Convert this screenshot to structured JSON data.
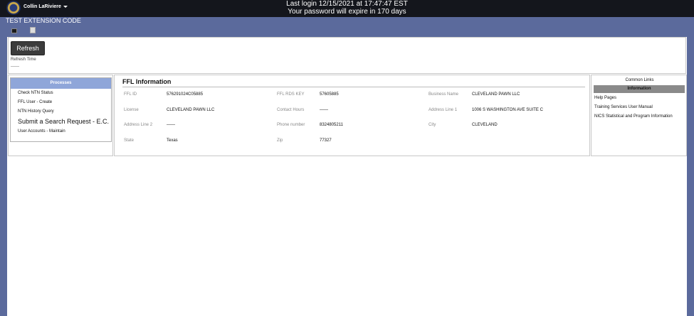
{
  "header": {
    "user_name": "Collin LaRiviere",
    "login_line": "Last login 12/15/2021 at 17:47:47 EST",
    "expire_line": "Your password will expire in 170 days"
  },
  "band": {
    "environment_title": "TEST EXTENSION CODE"
  },
  "refresh": {
    "button_label": "Refresh",
    "time_label": "Refresh Time",
    "time_value": "——"
  },
  "processes": {
    "header": "Processes",
    "items": [
      "Check NTN Status",
      "FFL User - Create",
      "NTN History Query",
      "Submit a Search Request - E.C.",
      "User Accounts - Maintain"
    ]
  },
  "ffl": {
    "title": "FFL Information",
    "fields": {
      "ffl_id": {
        "label": "FFL ID",
        "value": "576291024C05885"
      },
      "ffl_rds_key": {
        "label": "FFL RDS KEY",
        "value": "57605885"
      },
      "business_name": {
        "label": "Business Name",
        "value": "CLEVELAND PAWN LLC"
      },
      "license": {
        "label": "License",
        "value": "CLEVELAND PAWN LLC"
      },
      "contact_hours": {
        "label": "Contact Hours",
        "value": "——"
      },
      "address_line_1": {
        "label": "Address Line 1",
        "value": "1006 S WASHINGTON AVE SUITE C"
      },
      "address_line_2": {
        "label": "Address Line 2",
        "value": "——"
      },
      "phone_number": {
        "label": "Phone number",
        "value": "8324805211"
      },
      "city": {
        "label": "City",
        "value": "CLEVELAND"
      },
      "state": {
        "label": "State",
        "value": "Texas"
      },
      "zip": {
        "label": "Zip",
        "value": "77327"
      }
    }
  },
  "links": {
    "title": "Common Links",
    "info_header": "Information",
    "items": [
      "Help Pages",
      "Training Services User Manual",
      "NICS Statistical and Program Information"
    ]
  },
  "colors": {
    "topbar": "#14161c",
    "band": "#5b6a9c",
    "process_header": "#8fa6d9",
    "info_header": "#8a8a8a"
  },
  "icons": {
    "seal": "fbi-seal-icon",
    "caret": "chevron-down-icon",
    "small": "app-icon",
    "broken": "broken-image-icon"
  }
}
